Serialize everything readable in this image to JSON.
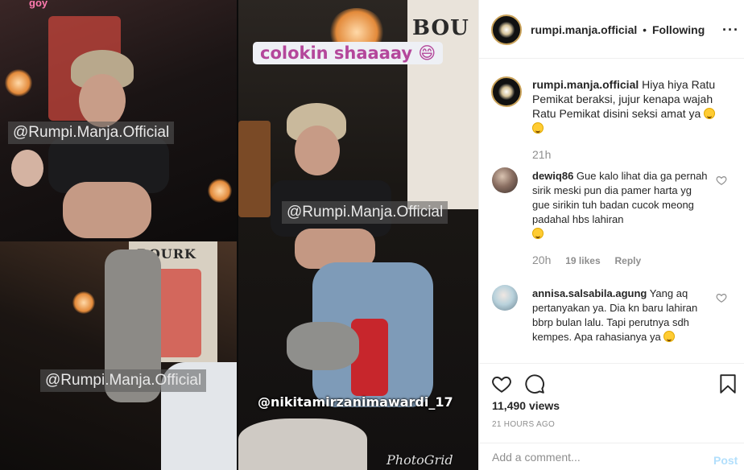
{
  "media": {
    "tile_top_left": {
      "watermark": "@Rumpi.Manja.Official",
      "corner_text": "goy"
    },
    "tile_bottom_left": {
      "watermark": "@Rumpi.Manja.Official",
      "sign_text": "BOURK"
    },
    "tile_right": {
      "sticker_text": "colokin shaaaay 😄",
      "watermark": "@Rumpi.Manja.Official",
      "sign_text": "BOU",
      "credit": "@nikitamirzanimawardi_17",
      "app_watermark": "PhotoGrid"
    }
  },
  "header": {
    "username": "rumpi.manja.official",
    "separator": "•",
    "follow_status": "Following",
    "more_icon": "more-horizontal-icon"
  },
  "caption": {
    "username": "rumpi.manja.official",
    "text": "Hiya hiya Ratu Pemikat beraksi, jujur kenapa wajah Ratu Pemikat disini seksi amat ya",
    "time": "21h"
  },
  "comments": [
    {
      "username": "dewiq86",
      "text": "Gue kalo lihat dia ga pernah sirik meski pun dia pamer harta yg gue sirikin tuh badan cucok meong padahal hbs lahiran",
      "time": "20h",
      "likes": "19 likes",
      "reply_label": "Reply"
    },
    {
      "username": "annisa.salsabila.agung",
      "text": "Yang aq pertanyakan ya. Dia kn baru lahiran bbrp bulan lalu. Tapi perutnya sdh kempes. Apa rahasianya ya"
    }
  ],
  "actions": {
    "views": "11,490 views",
    "time_ago": "21 HOURS AGO",
    "icons": [
      "heart-icon",
      "comment-icon",
      "bookmark-icon"
    ]
  },
  "add_comment": {
    "placeholder": "Add a comment...",
    "post_label": "Post"
  },
  "colors": {
    "link_blue_disabled": "#b2dffc",
    "secondary_text": "#8e8e8e",
    "primary_text": "#262626",
    "border": "#efefef"
  }
}
